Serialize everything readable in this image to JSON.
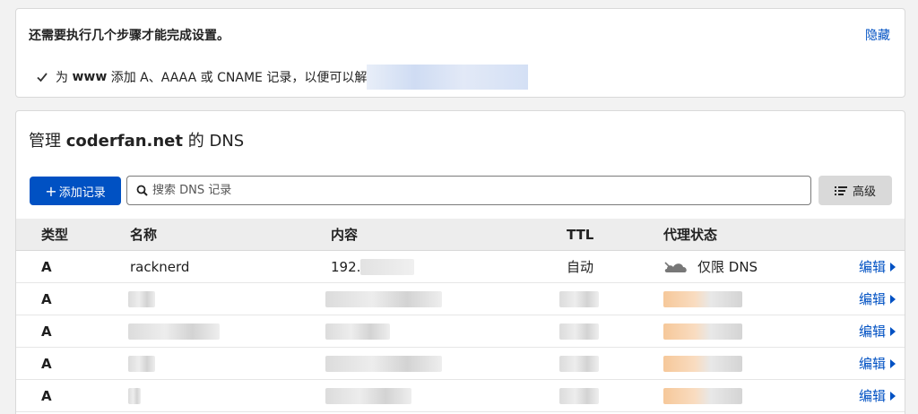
{
  "setup": {
    "title": "还需要执行几个步骤才能完成设置。",
    "hide_label": "隐藏",
    "step_prefix": "为",
    "step_bold": "www",
    "step_text": "添加 A、AAAA 或 CNAME 记录，以便可以解"
  },
  "dns": {
    "title_prefix": "管理",
    "domain": "coderfan.net",
    "title_suffix": "的 DNS",
    "add_label": "添加记录",
    "search_placeholder": "搜索 DNS 记录",
    "advanced_label": "高级",
    "columns": [
      "类型",
      "名称",
      "内容",
      "TTL",
      "代理状态"
    ],
    "rows": [
      {
        "type": "A",
        "name": "racknerd",
        "content": "192.",
        "ttl": "自动",
        "proxy": "仅限 DNS",
        "edit": "编辑"
      },
      {
        "type": "A",
        "edit": "编辑"
      },
      {
        "type": "A",
        "edit": "编辑"
      },
      {
        "type": "A",
        "edit": "编辑"
      },
      {
        "type": "A",
        "edit": "编辑"
      }
    ]
  },
  "colors": {
    "accent": "#0051c3",
    "header_bg": "#ededed",
    "page_bg": "#f2f2f2"
  },
  "icons": {
    "check": "check-icon",
    "search": "search-icon",
    "advanced": "filter-list-icon",
    "cloud": "cloud-dns-only-icon",
    "edit_arrow": "caret-right-icon"
  }
}
